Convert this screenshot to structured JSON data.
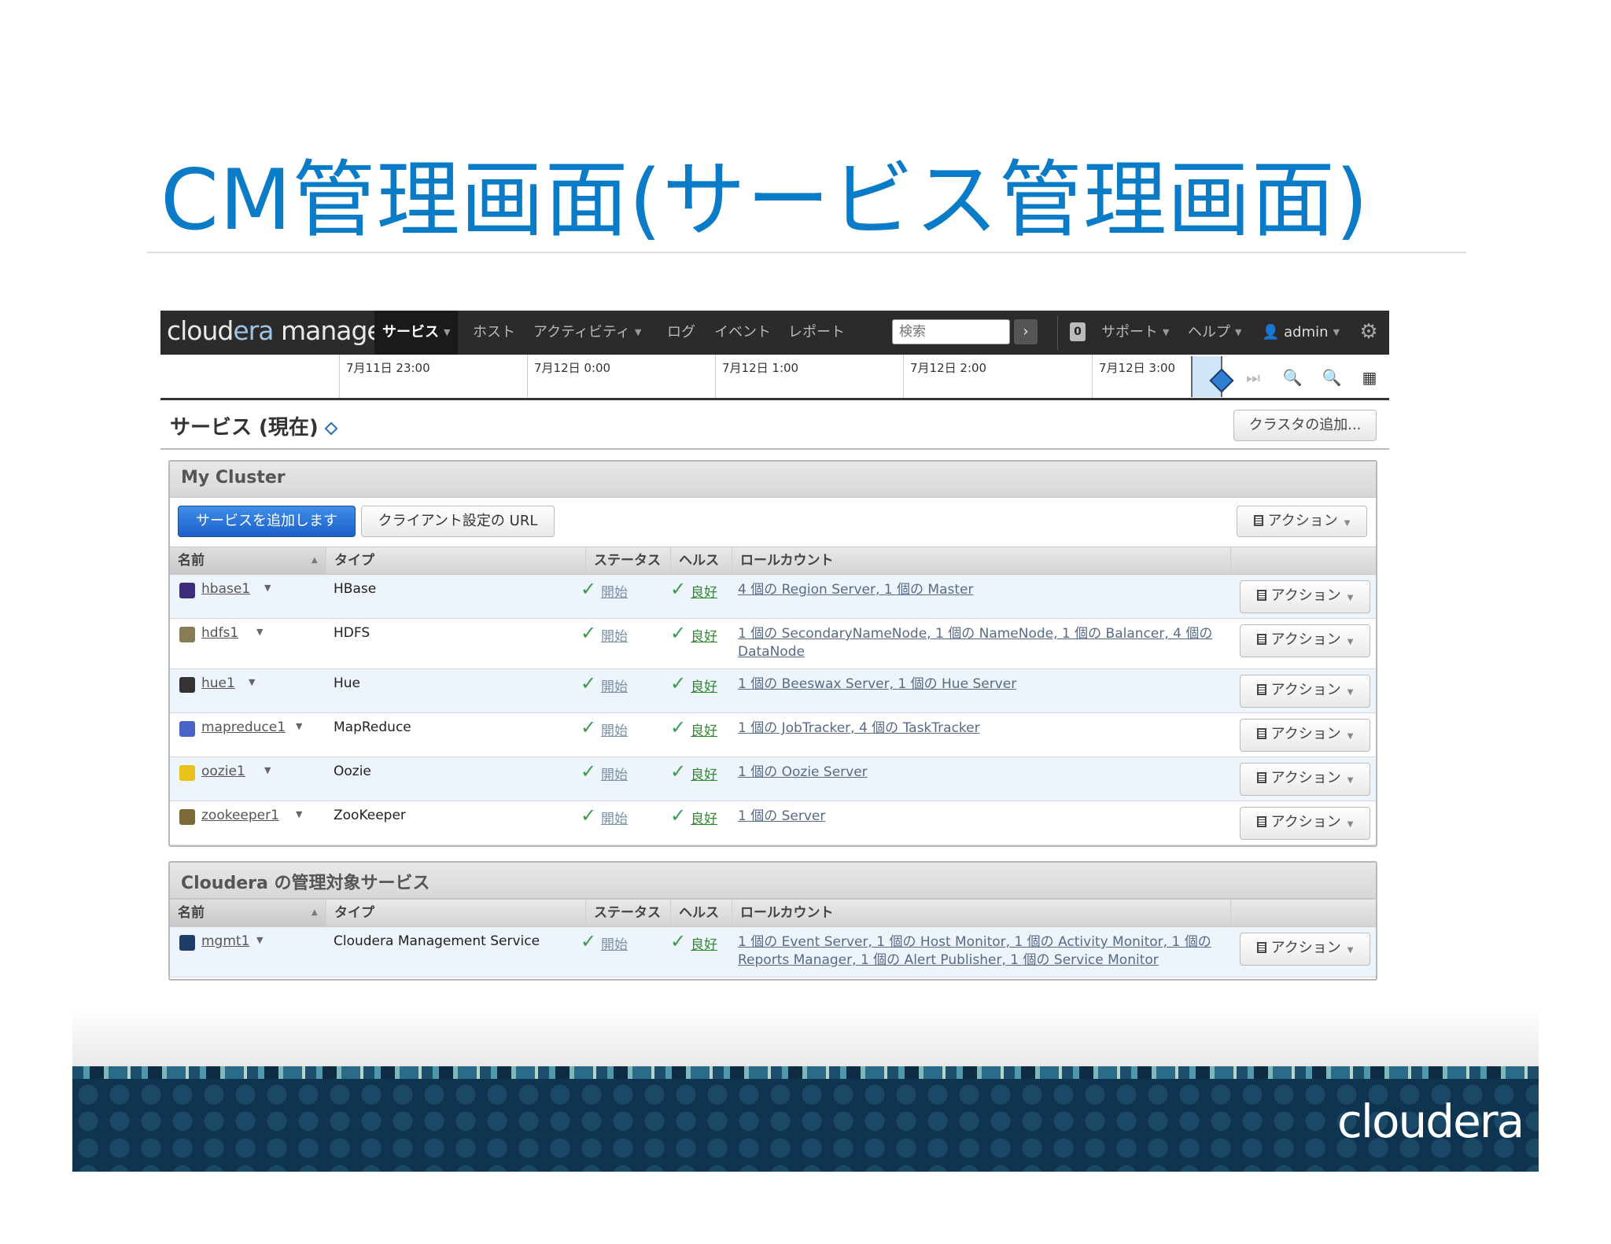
{
  "slide": {
    "title": "CM管理画面(サービス管理画面)"
  },
  "app": {
    "logo": {
      "part1": "cloud",
      "part2": "era",
      "part3": " manager"
    },
    "nav": {
      "services": "サービス",
      "hosts": "ホスト",
      "activities": "アクティビティ",
      "logs": "ログ",
      "events": "イベント",
      "reports": "レポート",
      "search_placeholder": "検索",
      "search_go": "›",
      "notif_count": "0",
      "support": "サポート",
      "help": "ヘルプ",
      "user": "admin"
    },
    "timeline": {
      "ticks": [
        "7月11日 23:00",
        "7月12日 0:00",
        "7月12日 1:00",
        "7月12日 2:00",
        "7月12日 3:00"
      ]
    },
    "services_header": {
      "title": "サービス (現在)",
      "add_cluster": "クラスタの追加..."
    },
    "cluster_panel": {
      "title": "My Cluster",
      "add_service": "サービスを追加します",
      "client_config_url": "クライアント設定の URL",
      "actions": "アクション"
    },
    "columns": {
      "name": "名前",
      "type": "タイプ",
      "status": "ステータス",
      "health": "ヘルス",
      "role_count": "ロールカウント"
    },
    "services": [
      {
        "name": "hbase1",
        "type": "HBase",
        "status": "開始",
        "health": "良好",
        "roles": "4 個の Region Server, 1 個の Master",
        "action": "アクション",
        "icon_color": "#3b2d7a"
      },
      {
        "name": "hdfs1",
        "type": "HDFS",
        "status": "開始",
        "health": "良好",
        "roles": "1 個の SecondaryNameNode, 1 個の NameNode, 1 個の Balancer, 4 個の DataNode",
        "action": "アクション",
        "icon_color": "#8a7a55"
      },
      {
        "name": "hue1",
        "type": "Hue",
        "status": "開始",
        "health": "良好",
        "roles": "1 個の Beeswax Server, 1 個の Hue Server",
        "action": "アクション",
        "icon_color": "#333333"
      },
      {
        "name": "mapreduce1",
        "type": "MapReduce",
        "status": "開始",
        "health": "良好",
        "roles": "1 個の JobTracker, 4 個の TaskTracker",
        "action": "アクション",
        "icon_color": "#4a63c9"
      },
      {
        "name": "oozie1",
        "type": "Oozie",
        "status": "開始",
        "health": "良好",
        "roles": "1 個の Oozie Server",
        "action": "アクション",
        "icon_color": "#e8c21a"
      },
      {
        "name": "zookeeper1",
        "type": "ZooKeeper",
        "status": "開始",
        "health": "良好",
        "roles": "1 個の Server",
        "action": "アクション",
        "icon_color": "#7a6a3a"
      }
    ],
    "mgmt_panel": {
      "title": "Cloudera の管理対象サービス"
    },
    "mgmt_services": [
      {
        "name": "mgmt1",
        "type": "Cloudera Management Service",
        "status": "開始",
        "health": "良好",
        "roles": "1 個の Event Server, 1 個の Host Monitor, 1 個の Activity Monitor, 1 個の Reports Manager, 1 個の Alert Publisher, 1 個の Service Monitor",
        "action": "アクション",
        "icon_color": "#1d3c66"
      }
    ]
  },
  "footer": {
    "logo": "cloudera"
  }
}
